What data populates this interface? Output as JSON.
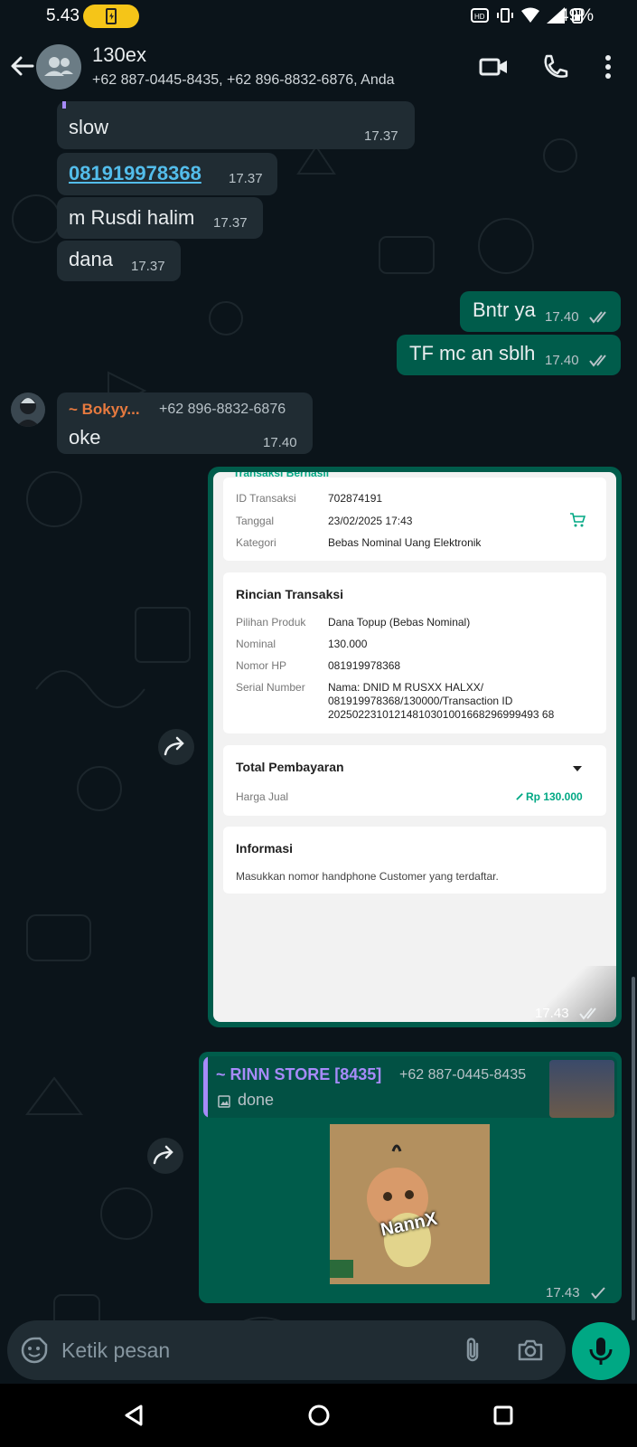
{
  "status_bar": {
    "time": "5.43",
    "battery_percent": "49%",
    "icons": [
      "battery-saver-icon",
      "hd-voice-icon",
      "vibrate-icon",
      "wifi-icon",
      "signal-icon",
      "battery-icon"
    ]
  },
  "header": {
    "title": "130ex",
    "members": "+62 887-0445-8435, +62 896-8832-6876, Anda",
    "icons": [
      "back-arrow-icon",
      "group-avatar-icon",
      "video-call-icon",
      "voice-call-icon",
      "more-vert-icon"
    ]
  },
  "messages": [
    {
      "from": "in",
      "text": "slow",
      "time": "17.37"
    },
    {
      "from": "in",
      "text": "081919978368",
      "time": "17.37"
    },
    {
      "from": "in",
      "text": "m Rusdi halim",
      "time": "17.37"
    },
    {
      "from": "in",
      "text": "dana",
      "time": "17.37"
    },
    {
      "from": "out",
      "text": "Bntr ya",
      "time": "17.40",
      "ticks": "read"
    },
    {
      "from": "out",
      "text": "TF mc an sblh",
      "time": "17.40",
      "ticks": "read"
    },
    {
      "from": "in",
      "sender": "~ Bokyy...",
      "sender_phone": "+62 896-8832-6876",
      "text": "oke",
      "time": "17.40"
    },
    {
      "from": "out",
      "type": "image",
      "time": "17.43",
      "ticks": "read"
    },
    {
      "from": "out",
      "quoted_sender": "~ RINN STORE [8435]",
      "quoted_phone": "+62 887-0445-8435",
      "quoted_text": "done",
      "type": "sticker",
      "sticker_caption": "NannX",
      "time": "17.43",
      "ticks": "sent"
    }
  ],
  "receipt": {
    "partial_title": "Transaksi Berhasil",
    "summary": {
      "id_label": "ID Transaksi",
      "id_value": "702874191",
      "date_label": "Tanggal",
      "date_value": "23/02/2025 17:43",
      "category_label": "Kategori",
      "category_value": "Bebas Nominal Uang Elektronik"
    },
    "details": {
      "heading": "Rincian Transaksi",
      "product_label": "Pilihan Produk",
      "product_value": "Dana Topup (Bebas Nominal)",
      "nominal_label": "Nominal",
      "nominal_value": "130.000",
      "phone_label": "Nomor HP",
      "phone_value": "081919978368",
      "serial_label": "Serial Number",
      "serial_line1": "Nama: DNID M RUSXX HALXX/",
      "serial_line2": "081919978368/130000/Transaction ID",
      "serial_line3": "20250223101214810301001668296999493 68"
    },
    "payment": {
      "heading": "Total Pembayaran",
      "price_label": "Harga Jual",
      "price_value": "Rp 130.000"
    },
    "info": {
      "heading": "Informasi",
      "text": "Masukkan nomor handphone Customer yang terdaftar."
    }
  },
  "composer": {
    "placeholder": "Ketik pesan"
  },
  "colors": {
    "incoming": "#202c33",
    "outgoing": "#005c4b",
    "accent": "#00a884",
    "link": "#53bdeb",
    "sender": "#e77a3f",
    "quote_bar": "#a78bfa"
  }
}
